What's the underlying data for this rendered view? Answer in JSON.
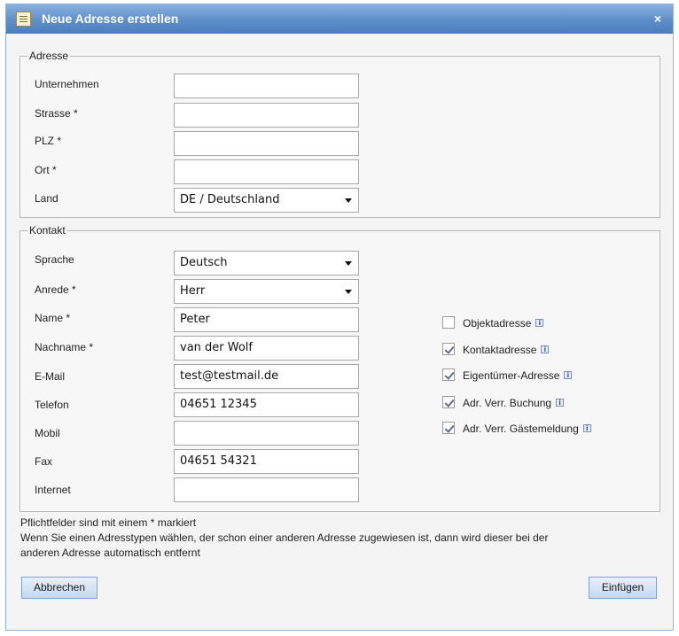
{
  "window": {
    "title": "Neue Adresse erstellen",
    "title_icon": "notepad-icon",
    "close_symbol": "×"
  },
  "address": {
    "legend": "Adresse",
    "fields": [
      {
        "label": "Unternehmen",
        "value": ""
      },
      {
        "label": "Strasse *",
        "value": ""
      },
      {
        "label": "PLZ *",
        "value": ""
      },
      {
        "label": "Ort *",
        "value": ""
      }
    ],
    "country": {
      "label": "Land",
      "value": "DE / Deutschland"
    }
  },
  "contact": {
    "legend": "Kontakt",
    "language": {
      "label": "Sprache",
      "value": "Deutsch"
    },
    "salutation": {
      "label": "Anrede *",
      "value": "Herr"
    },
    "fields": [
      {
        "label": "Name *",
        "value": "Peter"
      },
      {
        "label": "Nachname *",
        "value": "van der Wolf"
      },
      {
        "label": "E-Mail",
        "value": "test@testmail.de"
      },
      {
        "label": "Telefon",
        "value": "04651 12345"
      },
      {
        "label": "Mobil",
        "value": ""
      },
      {
        "label": "Fax",
        "value": "04651  54321"
      },
      {
        "label": "Internet",
        "value": ""
      }
    ],
    "address_types": [
      {
        "label": "Objektadresse",
        "checked": false
      },
      {
        "label": "Kontaktadresse",
        "checked": true
      },
      {
        "label": "Eigentümer-Adresse",
        "checked": true
      },
      {
        "label": "Adr. Verr. Buchung",
        "checked": true
      },
      {
        "label": "Adr. Verr. Gästemeldung",
        "checked": true
      }
    ],
    "info_symbol": "i"
  },
  "notes": {
    "required": "Pflichtfelder sind mit einem * markiert",
    "line1": "Wenn Sie einen Adresstypen wählen, der schon einer anderen Adresse zugewiesen ist, dann wird dieser bei der",
    "line2": "anderen Adresse automatisch entfernt"
  },
  "buttons": {
    "cancel": "Abbrechen",
    "insert": "Einfügen"
  },
  "colors": {
    "titlebar": "#5e8fcb",
    "button": "#c5d8ef"
  }
}
